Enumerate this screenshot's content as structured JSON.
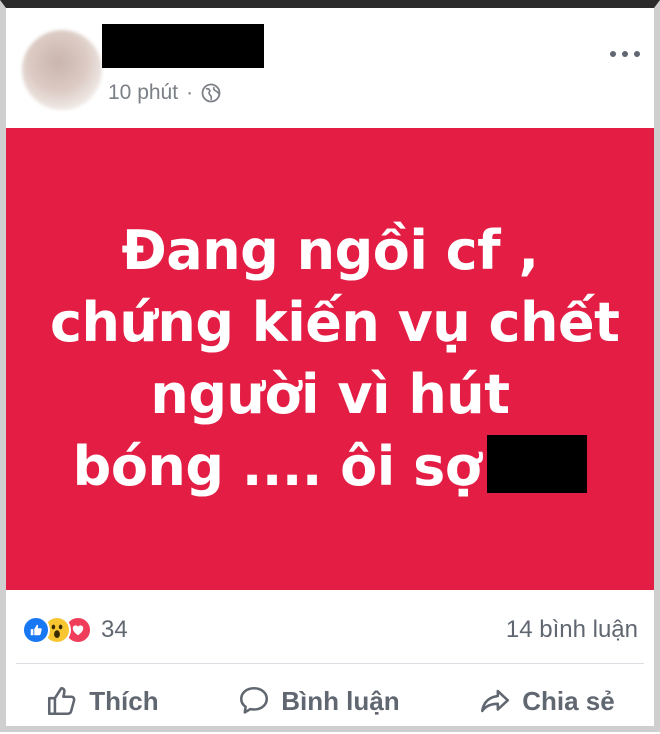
{
  "post": {
    "timestamp": "10 phút",
    "separator": "·",
    "privacy_icon": "globe-icon",
    "more_icon": "more-options-icon"
  },
  "banner": {
    "background_color": "#e31d44",
    "lines": [
      "Đang ngồi cf ,",
      "chứng kiến vụ chết",
      "người vì hút",
      "bóng .... ôi sợ"
    ]
  },
  "stats": {
    "reaction_icons": [
      "like-icon",
      "wow-icon",
      "love-icon"
    ],
    "reaction_count": "34",
    "comments_count": "14 bình luận"
  },
  "actions": {
    "like_label": "Thích",
    "comment_label": "Bình luận",
    "share_label": "Chia sẻ"
  },
  "colors": {
    "accent_blue": "#1877f2",
    "muted_text": "#606770"
  }
}
